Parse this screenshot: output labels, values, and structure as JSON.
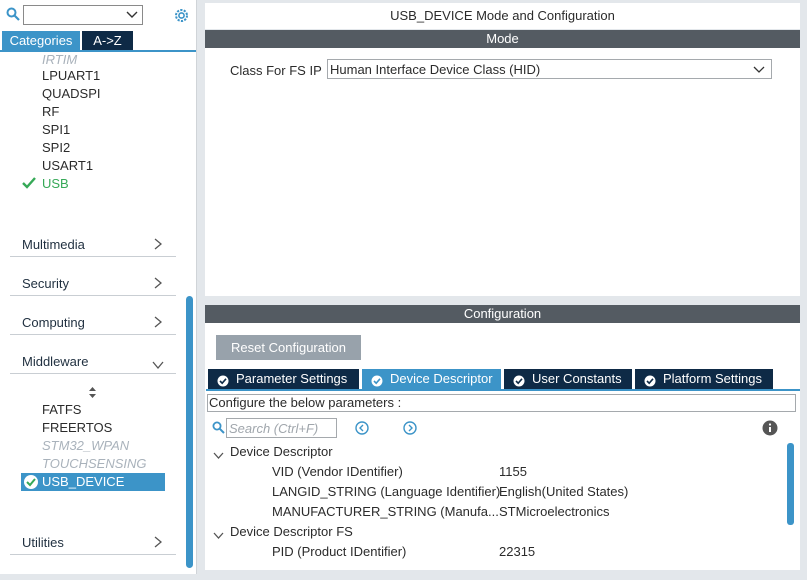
{
  "sidebar": {
    "search": {
      "value": ""
    },
    "tabs": {
      "categories": "Categories",
      "az": "A->Z"
    },
    "peripherals": [
      {
        "label": "IRTIM",
        "state": "dim"
      },
      {
        "label": "LPUART1",
        "state": "normal"
      },
      {
        "label": "QUADSPI",
        "state": "normal"
      },
      {
        "label": "RF",
        "state": "normal"
      },
      {
        "label": "SPI1",
        "state": "normal"
      },
      {
        "label": "SPI2",
        "state": "normal"
      },
      {
        "label": "USART1",
        "state": "normal"
      },
      {
        "label": "USB",
        "state": "ok"
      }
    ],
    "categories": {
      "multimedia": "Multimedia",
      "security": "Security",
      "computing": "Computing",
      "middleware": "Middleware",
      "utilities": "Utilities"
    },
    "middleware_items": [
      {
        "label": "FATFS",
        "state": "normal"
      },
      {
        "label": "FREERTOS",
        "state": "normal"
      },
      {
        "label": "STM32_WPAN",
        "state": "dim"
      },
      {
        "label": "TOUCHSENSING",
        "state": "dim"
      },
      {
        "label": "USB_DEVICE",
        "state": "selected"
      }
    ]
  },
  "window": {
    "title": "USB_DEVICE Mode and Configuration"
  },
  "mode": {
    "header": "Mode",
    "class_label": "Class For FS IP",
    "class_value": "Human Interface Device Class (HID)"
  },
  "config": {
    "header": "Configuration",
    "reset_label": "Reset Configuration",
    "tabs": {
      "parameter_settings": "Parameter Settings",
      "device_descriptor": "Device Descriptor",
      "user_constants": "User Constants",
      "platform_settings": "Platform Settings"
    },
    "hint": "Configure the below parameters :",
    "search_placeholder": "Search (Ctrl+F)",
    "groups": [
      {
        "title": "Device Descriptor",
        "params": [
          {
            "name": "VID (Vendor IDentifier)",
            "value": "1155"
          },
          {
            "name": "LANGID_STRING (Language Identifier)",
            "value": "English(United States)"
          },
          {
            "name": "MANUFACTURER_STRING (Manufa...",
            "value": "STMicroelectronics"
          }
        ]
      },
      {
        "title": "Device Descriptor FS",
        "params": [
          {
            "name": "PID (Product IDentifier)",
            "value": "22315"
          }
        ]
      }
    ]
  },
  "colors": {
    "accent": "#3c94c8",
    "dark_navy": "#0e2a46",
    "ok_green": "#36a957",
    "header_gray": "#545b62"
  }
}
